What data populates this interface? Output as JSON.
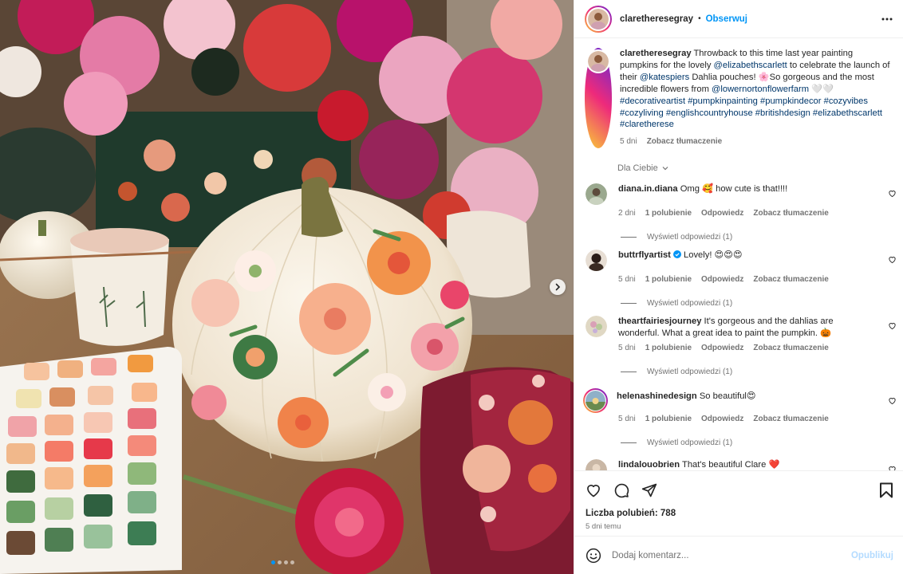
{
  "post": {
    "username": "claretheresegray",
    "follow_label": "Obserwuj",
    "separator": "•",
    "more_icon": "more-horizontal-icon",
    "image_nav_icon": "chevron-right-icon",
    "carousel": {
      "count": 4,
      "active": 1
    }
  },
  "caption": {
    "username": "claretheresegray",
    "t1": " Throwback to this time last year painting pumpkins for the lovely ",
    "m1": "@elizabethscarlett",
    "t2": " to celebrate the launch of their ",
    "m2": "@katespiers",
    "t3": " Dahlia pouches! 🌸So gorgeous and the most incredible flowers from ",
    "m3": "@lowernortonflowerfarm",
    "t4": " 🤍🤍",
    "hashtags": "#decorativeartist #pumpkinpainting #pumpkindecor #cozyvibes #cozyliving #englishcountryhouse #britishdesign #elizabethscarlett #claretherese",
    "time": "5 dni",
    "translate": "Zobacz tłumaczenie"
  },
  "for_you_label": "Dla Ciebie",
  "comments": [
    {
      "username": "diana.in.diana",
      "text": " Omg 🥰 how cute is that!!!!",
      "time": "2 dni",
      "likes": "1 polubienie",
      "reply": "Odpowiedz",
      "translate": "Zobacz tłumaczenie",
      "view_replies": "Wyświetl odpowiedzi (1)"
    },
    {
      "username": "buttrflyartist",
      "text": " Lovely! 😍😍😍",
      "time": "5 dni",
      "likes": "1 polubienie",
      "reply": "Odpowiedz",
      "translate": "Zobacz tłumaczenie",
      "view_replies": "Wyświetl odpowiedzi (1)"
    },
    {
      "username": "theartfairiesjourney",
      "text": " It's gorgeous and the dahlias are wonderful. What a great idea to paint the pumpkin. 🎃",
      "time": "5 dni",
      "likes": "1 polubienie",
      "reply": "Odpowiedz",
      "translate": "Zobacz tłumaczenie",
      "view_replies": "Wyświetl odpowiedzi (1)"
    },
    {
      "username": "helenashinedesign",
      "text": " So beautiful😍",
      "time": "5 dni",
      "likes": "1 polubienie",
      "reply": "Odpowiedz",
      "translate": "Zobacz tłumaczenie",
      "view_replies": "Wyświetl odpowiedzi (1)"
    },
    {
      "username": "lindalouobrien",
      "text": " That's beautiful Clare ❤️"
    }
  ],
  "actions": {
    "like_icon": "heart-icon",
    "comment_icon": "comment-icon",
    "share_icon": "paper-plane-icon",
    "save_icon": "bookmark-icon",
    "likes_text": "Liczba polubień: 788",
    "date": "5 dni temu"
  },
  "add_comment": {
    "placeholder": "Dodaj komentarz...",
    "post_label": "Opublikuj",
    "emoji_icon": "emoji-icon"
  },
  "colors": {
    "accent": "#0095f6",
    "link": "#00376b",
    "muted": "#737373",
    "verified": "#0095f6"
  }
}
